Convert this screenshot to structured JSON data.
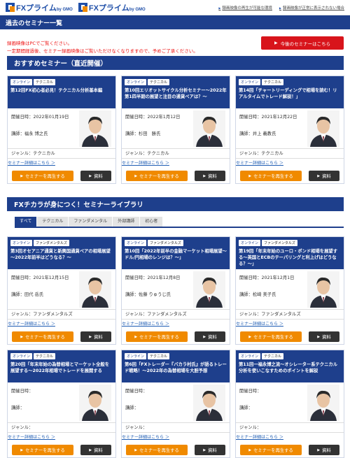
{
  "header": {
    "logo1": {
      "main": "FXプライム",
      "sub": "by GMO"
    },
    "logo2": {
      "main": "FXプライム",
      "sub": "by GMO"
    },
    "links": [
      "録画映像の再生が可能な環境",
      "録画映像が正常に表示されない場合"
    ]
  },
  "page_title": "過去のセミナー一覧",
  "notice": {
    "line1": "録画映像はPCでご覧ください。",
    "line2": "一定期間経過後、セミナー録画映像はご覧いただけなくなりますので、予めご了承ください。"
  },
  "upcoming_button": "今後のセミナーはこちら",
  "section1": {
    "title": "おすすめセミナー（直近開催）"
  },
  "section2": {
    "title": "FXチカラが身につく！セミナーライブラリ"
  },
  "tabs": [
    "すべて",
    "テクニカル",
    "ファンダメンタル",
    "外部講師",
    "初心者"
  ],
  "labels": {
    "date_prefix": "開催日時：",
    "lecturer_prefix": "講師：",
    "genre_prefix": "ジャンル：",
    "detail_link": "セミナー詳細はこちら ＞",
    "play_button": "セミナーを再生する",
    "doc_button": "資料"
  },
  "cards_recommended": [
    {
      "tags": [
        "オンライン",
        "テクニカル"
      ],
      "title": "第12回FX初心者必見！テクニカル分析基本編",
      "date": "2022年01月19日",
      "lecturer": "福永 博之氏",
      "genre": "テクニカル"
    },
    {
      "tags": [
        "オンライン",
        "テクニカル"
      ],
      "title": "第10回エリオットサイクル分析セミナー～2022年第1四半期の展望と注目の通貨ペアは？～",
      "date": "2022年1月12日",
      "lecturer": "杉田　勝氏",
      "genre": "テクニカル"
    },
    {
      "tags": [
        "オンライン",
        "テクニカル"
      ],
      "title": "第14回「チャートリーディングで相場を読む！リアルタイムでトレード解説！」",
      "date": "2021年12月22日",
      "lecturer": "井上 義教氏",
      "genre": "テクニカル"
    }
  ],
  "cards_library": [
    {
      "tags": [
        "オンライン",
        "ファンダメンタルズ"
      ],
      "title": "第3回オセアニア通貨と新興国通貨ペアの相場展望～2022年前半はどうなる？～",
      "date": "2021年12月15日",
      "lecturer": "田代 岳氏",
      "genre": "ファンダメンタルズ"
    },
    {
      "tags": [
        "オンライン",
        "ファンダメンタルズ"
      ],
      "title": "第10回「2022年前半の金融マーケット相場展望～ドル/円相場のレンジは？～」",
      "date": "2021年12月8日",
      "lecturer": "佐藤 りゅうじ氏",
      "genre": "ファンダメンタルズ"
    },
    {
      "tags": [
        "オンライン",
        "ファンダメンタルズ"
      ],
      "title": "第19回「年末年始のユーロ・ポンド相場を展望する～英国とECBのテーパリングと利上げはどうなる？～」",
      "date": "2021年12月1日",
      "lecturer": "松崎 美子氏",
      "genre": "ファンダメンタルズ"
    }
  ],
  "cards_partial": [
    {
      "tags": [
        "オンライン",
        "テクニカル"
      ],
      "title": "第20回「年末年始の為替相場とマーケット全般を展望する～2022年相場でトレードを展開する"
    },
    {
      "tags": [
        "オンライン",
        "テクニカル"
      ],
      "title": "第6回「FXトレーダー『バカラ村氏』が語るトレード戦略！～2022年の為替相場を大胆予想"
    },
    {
      "tags": [
        "オンライン",
        "テクニカル"
      ],
      "title": "第11回一福永博之流～オシレーター系テクニカル分析を使いこなすためのポイントを解説"
    }
  ],
  "colors": {
    "navy": "#1e3f8c",
    "orange": "#f08a00",
    "red": "#d8141b"
  }
}
